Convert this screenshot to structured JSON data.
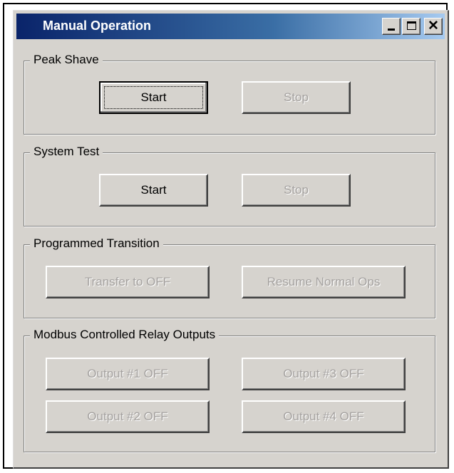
{
  "window": {
    "title": "Manual Operation",
    "controls": {
      "minimize": "_",
      "maximize": "□",
      "close": "✕"
    }
  },
  "groups": {
    "peak_shave": {
      "label": "Peak Shave",
      "start": "Start",
      "stop": "Stop"
    },
    "system_test": {
      "label": "System Test",
      "start": "Start",
      "stop": "Stop"
    },
    "programmed_transition": {
      "label": "Programmed Transition",
      "transfer": "Transfer to OFF",
      "resume": "Resume Normal Ops"
    },
    "relay_outputs": {
      "label": "Modbus Controlled Relay Outputs",
      "outputs": [
        "Output #1 OFF",
        "Output #2 OFF",
        "Output #3 OFF",
        "Output #4 OFF"
      ]
    }
  },
  "colors": {
    "face": "#d6d3ce",
    "title_start": "#0a246a",
    "title_end": "#a6caf0",
    "disabled_text": "#a5a2a0"
  }
}
